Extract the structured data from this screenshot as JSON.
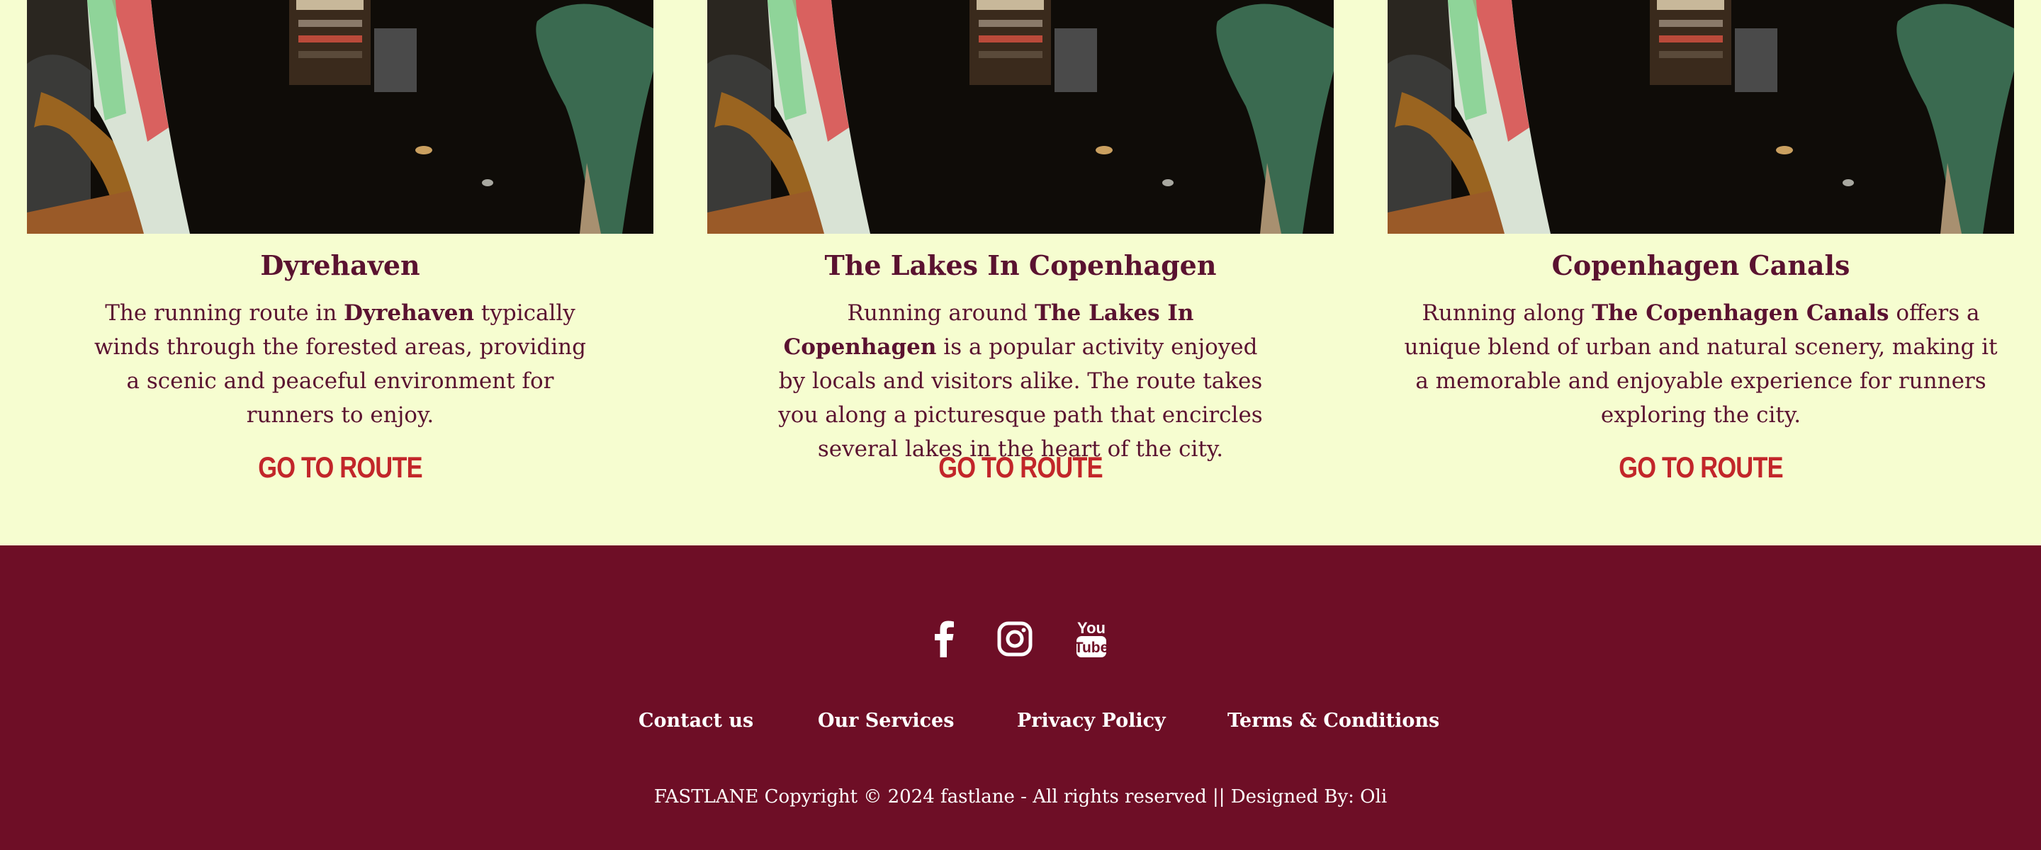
{
  "cards": [
    {
      "title": "Dyrehaven",
      "desc_before": "The running route in ",
      "desc_bold": "Dyrehaven",
      "desc_after": " typically winds through the forested areas, providing a scenic and peaceful environment for runners to enjoy.",
      "link_label": "GO TO ROUTE"
    },
    {
      "title": "The Lakes In Copenhagen",
      "desc_before": "Running around ",
      "desc_bold": "The Lakes In Copenhagen",
      "desc_after": " is a popular activity enjoyed by locals and visitors alike. The route takes you along a picturesque path that encircles several lakes in the heart of the city.",
      "link_label": "GO TO ROUTE"
    },
    {
      "title": "Copenhagen Canals",
      "desc_before": "Running along ",
      "desc_bold": "The Copenhagen Canals",
      "desc_after": " offers a unique blend of urban and natural scenery, making it a memorable and enjoyable experience for runners exploring the city.",
      "link_label": "GO TO ROUTE"
    }
  ],
  "footer": {
    "social": [
      {
        "icon": "facebook-icon"
      },
      {
        "icon": "instagram-icon"
      },
      {
        "icon": "youtube-icon",
        "text_top": "You",
        "text_bottom": "Tube"
      }
    ],
    "links": [
      "Contact us",
      "Our Services",
      "Privacy Policy",
      "Terms & Conditions"
    ],
    "copyright": "FASTLANE Copyright © 2024 fastlane - All rights reserved || Designed By: Oli"
  },
  "colors": {
    "background": "#f6fdd0",
    "footer": "#6e0e26",
    "heading": "#5a1230",
    "link": "#c2262a"
  }
}
